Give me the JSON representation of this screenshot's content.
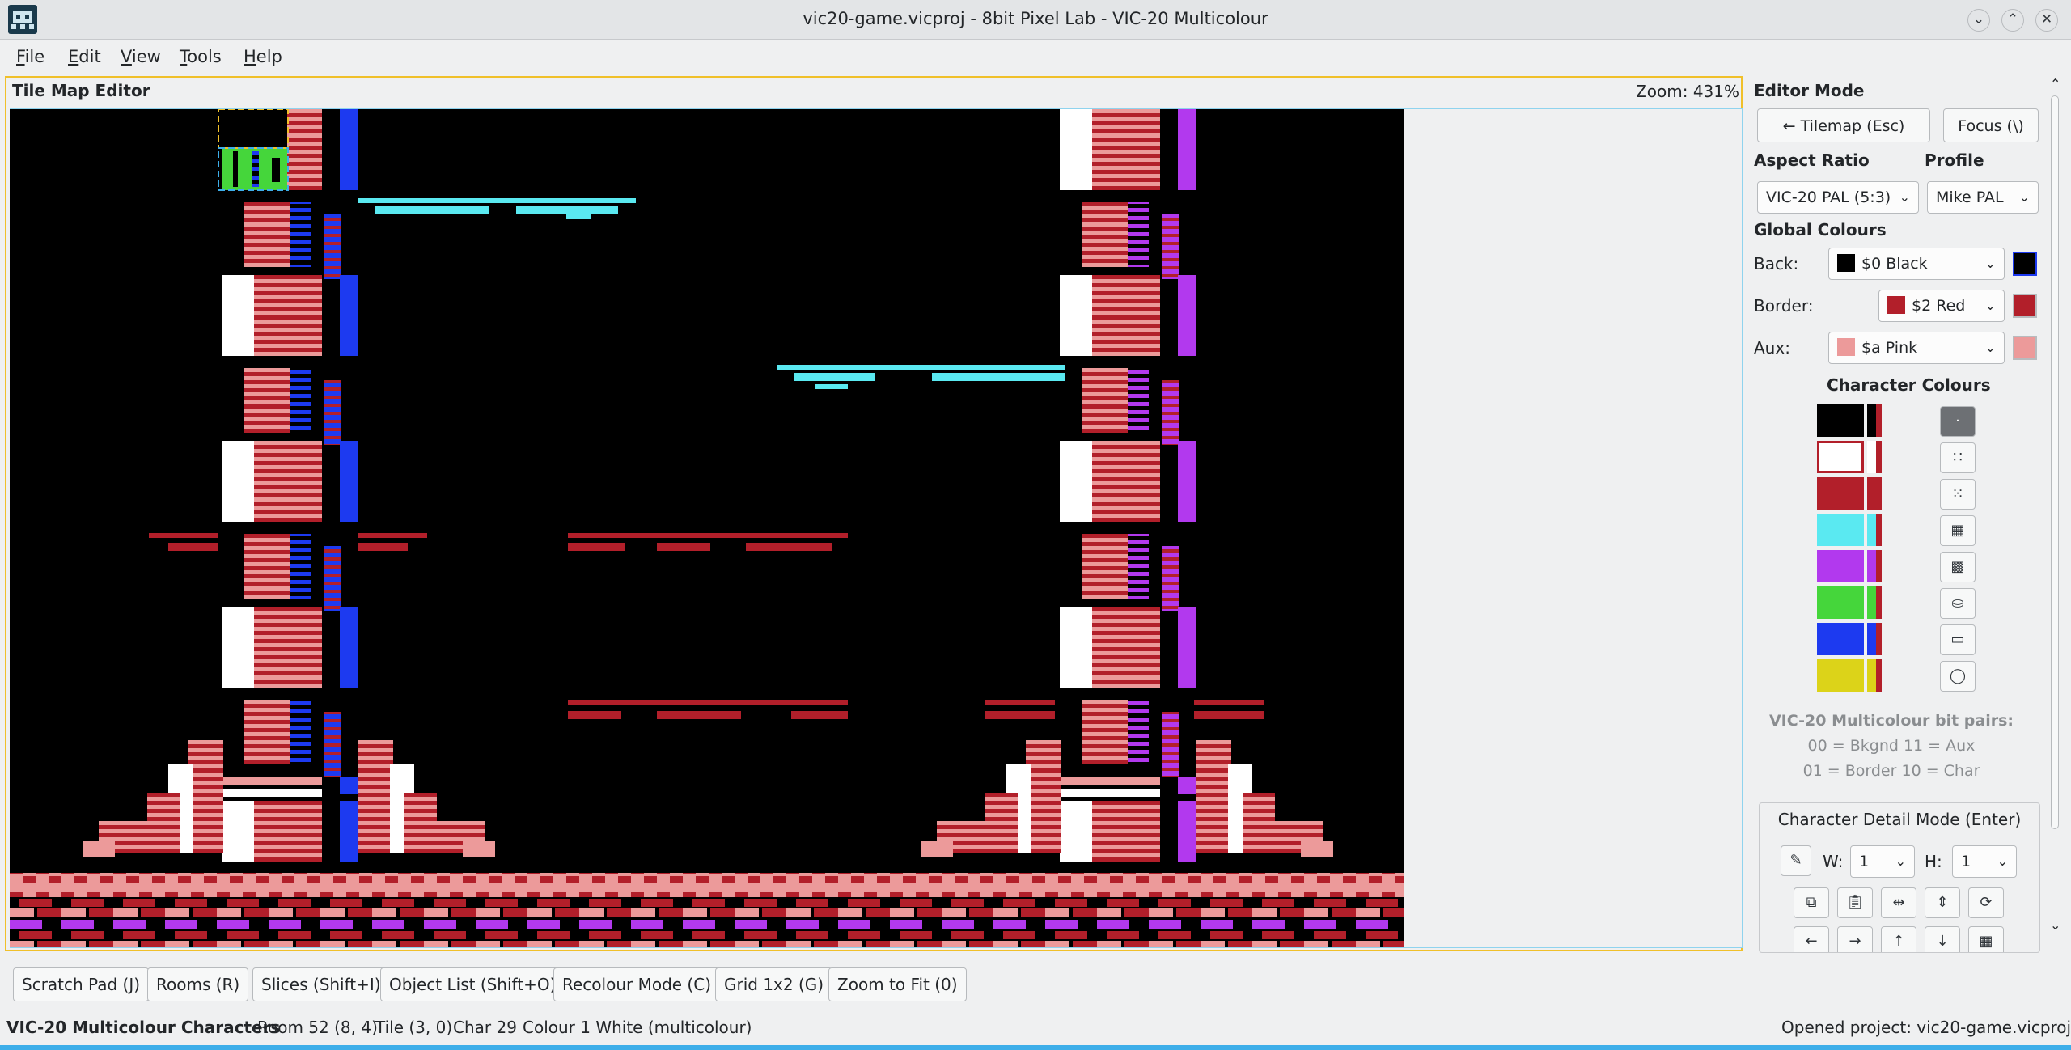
{
  "window": {
    "title": "vic20-game.vicproj - 8bit Pixel Lab - VIC-20 Multicolour",
    "minimize_glyph": "⌄",
    "maximize_glyph": "⌃",
    "close_glyph": "✕"
  },
  "menu": [
    {
      "label": "File",
      "accel": "F",
      "rest": "ile"
    },
    {
      "label": "Edit",
      "accel": "E",
      "rest": "dit"
    },
    {
      "label": "View",
      "accel": "V",
      "rest": "iew"
    },
    {
      "label": "Tools",
      "accel": "T",
      "rest": "ools"
    },
    {
      "label": "Help",
      "accel": "H",
      "rest": "elp"
    }
  ],
  "editor": {
    "title": "Tile Map Editor",
    "zoom": "Zoom: 431%"
  },
  "panel": {
    "editor_mode_heading": "Editor Mode",
    "tilemap_button": "← Tilemap (Esc)",
    "focus_button": "Focus (\\)",
    "aspect_ratio_heading": "Aspect Ratio",
    "profile_heading": "Profile",
    "aspect_ratio_value": "VIC-20 PAL (5:3)",
    "profile_value": "Mike PAL",
    "global_colours_heading": "Global Colours",
    "back_label": "Back:",
    "back_value": "$0 Black",
    "border_label": "Border:",
    "border_value": "$2 Red",
    "aux_label": "Aux:",
    "aux_value": "$a Pink",
    "character_colours_heading": "Character Colours",
    "bitpairs_title": "VIC-20 Multicolour bit pairs:",
    "bitpairs_line1": "00 = Bkgnd  11 = Aux",
    "bitpairs_line2": "01 = Border  10 = Char",
    "detail_mode_title": "Character Detail Mode (Enter)",
    "w_label": "W:",
    "w_value": "1",
    "h_label": "H:",
    "h_value": "1"
  },
  "colors": {
    "black": "#000000",
    "white": "#ffffff",
    "red": "#b21f2a",
    "cyan": "#5ae9f1",
    "purple": "#b239ee",
    "green": "#45d63b",
    "blue": "#1d3af0",
    "yellow": "#dcd319",
    "pink": "#ec9a9a",
    "accent": "#f0c02a",
    "selection": "#3daee9"
  },
  "character_colours": [
    "#000000",
    "#ffffff",
    "#b21f2a",
    "#5ae9f1",
    "#b239ee",
    "#45d63b",
    "#1d3af0",
    "#dcd319"
  ],
  "bottom_buttons": [
    "Scratch Pad (J)",
    "Rooms (R)",
    "Slices (Shift+I)",
    "Object List (Shift+O)",
    "Recolour Mode (C)",
    "Grid 1x2 (G)",
    "Zoom to Fit (0)"
  ],
  "status": {
    "mode": "VIC-20 Multicolour Characters",
    "room": "Room 52 (8, 4)",
    "tile": "Tile (3, 0)",
    "char": "Char 29",
    "colour": "Colour 1 White (multicolour)",
    "project": "Opened project: vic20-game.vicproj"
  }
}
